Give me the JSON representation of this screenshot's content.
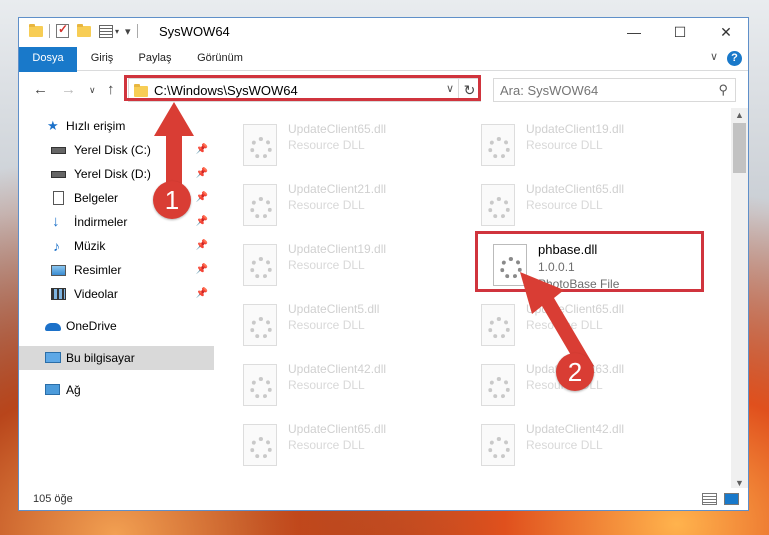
{
  "window": {
    "title": "SysWOW64",
    "minimize_glyph": "—",
    "maximize_glyph": "☐",
    "close_glyph": "✕"
  },
  "ribbon": {
    "tabs": [
      "Dosya",
      "Giriş",
      "Paylaş",
      "Görünüm"
    ],
    "help": "?",
    "chevron": "∨"
  },
  "nav": {
    "back": "←",
    "forward": "→",
    "recent": "∨",
    "up": "↑"
  },
  "address": {
    "path": "C:\\Windows\\SysWOW64",
    "dropdown": "∨",
    "refresh": "↻"
  },
  "search": {
    "placeholder": "Ara: SysWOW64",
    "icon": "⚲"
  },
  "sidebar": {
    "items": [
      {
        "label": "Hızlı erişim",
        "icon": "star-icon",
        "pinned": false
      },
      {
        "label": "Yerel Disk (C:)",
        "icon": "drive-icon",
        "pinned": true
      },
      {
        "label": "Yerel Disk (D:)",
        "icon": "drive-icon",
        "pinned": true
      },
      {
        "label": "Belgeler",
        "icon": "document-icon",
        "pinned": true
      },
      {
        "label": "İndirmeler",
        "icon": "download-icon",
        "pinned": true
      },
      {
        "label": "Müzik",
        "icon": "music-icon",
        "pinned": true
      },
      {
        "label": "Resimler",
        "icon": "pictures-icon",
        "pinned": true
      },
      {
        "label": "Videolar",
        "icon": "video-icon",
        "pinned": true
      },
      {
        "label": "OneDrive",
        "icon": "cloud-icon",
        "pinned": false
      },
      {
        "label": "Bu bilgisayar",
        "icon": "computer-icon",
        "pinned": false,
        "selected": true
      },
      {
        "label": "Ağ",
        "icon": "network-icon",
        "pinned": false
      }
    ],
    "pin_glyph": "📌"
  },
  "files": [
    {
      "name": "UpdateClient65.dll",
      "type": "Resource DLL"
    },
    {
      "name": "UpdateClient19.dll",
      "type": "Resource DLL"
    },
    {
      "name": "UpdateClient21.dll",
      "type": "Resource DLL"
    },
    {
      "name": "UpdateClient65.dll",
      "type": "Resource DLL"
    },
    {
      "name": "UpdateClient19.dll",
      "type": "Resource DLL"
    },
    {
      "name": "phbase.dll",
      "version": "1.0.0.1",
      "type": "PhotoBase File",
      "highlighted": true
    },
    {
      "name": "UpdateClient5.dll",
      "type": "Resource DLL"
    },
    {
      "name": "UpdateClient65.dll",
      "type": "Resource DLL"
    },
    {
      "name": "UpdateClient42.dll",
      "type": "Resource DLL"
    },
    {
      "name": "UpdateClient63.dll",
      "type": "Resource DLL"
    },
    {
      "name": "UpdateClient65.dll",
      "type": "Resource DLL"
    },
    {
      "name": "UpdateClient42.dll",
      "type": "Resource DLL"
    }
  ],
  "status": {
    "count": "105 öğe"
  },
  "annotations": {
    "step1": "1",
    "step2": "2",
    "color": "#d0343d"
  }
}
